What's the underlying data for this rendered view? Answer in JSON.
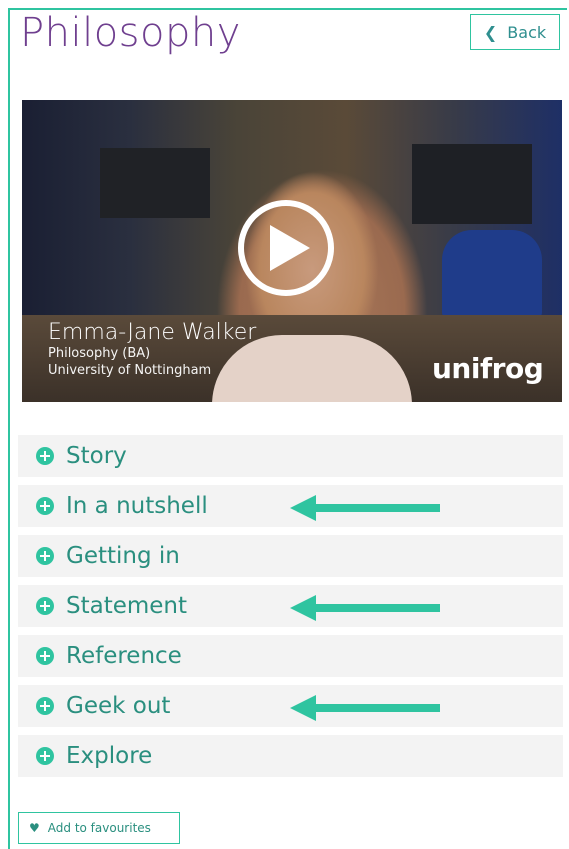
{
  "header": {
    "title": "Philosophy",
    "back_label": "Back"
  },
  "video": {
    "person_name": "Emma-Jane Walker",
    "course": "Philosophy (BA)",
    "university": "University of Nottingham",
    "brand": "unifrog"
  },
  "accordion": {
    "items": [
      {
        "label": "Story",
        "arrow": false
      },
      {
        "label": "In a nutshell",
        "arrow": true
      },
      {
        "label": "Getting in",
        "arrow": false
      },
      {
        "label": "Statement",
        "arrow": true
      },
      {
        "label": "Reference",
        "arrow": false
      },
      {
        "label": "Geek out",
        "arrow": true
      },
      {
        "label": "Explore",
        "arrow": false
      }
    ]
  },
  "favourites": {
    "label": "Add to favourites"
  },
  "colors": {
    "accent": "#2fc4a0",
    "title": "#6f3f8f",
    "label": "#2a8f7f"
  }
}
